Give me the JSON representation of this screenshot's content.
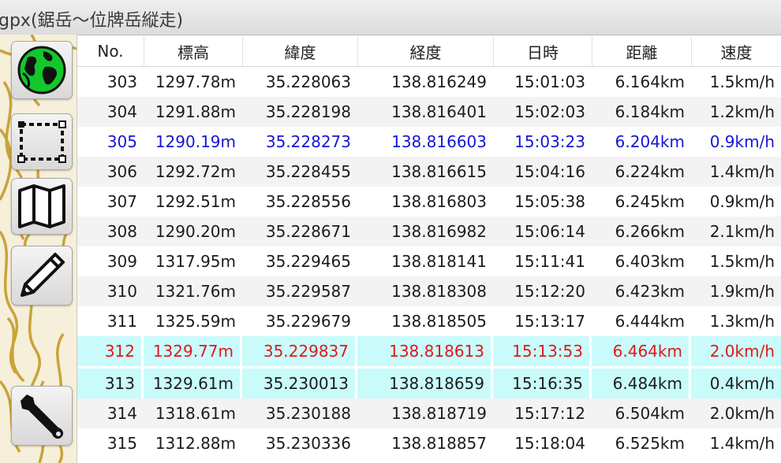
{
  "window": {
    "title": "gpx(鋸岳〜位牌岳縦走)"
  },
  "toolbar": {
    "buttons": [
      {
        "id": "globe",
        "icon": "globe-icon"
      },
      {
        "id": "select",
        "icon": "selection-rect-icon"
      },
      {
        "id": "map",
        "icon": "map-icon"
      },
      {
        "id": "edit",
        "icon": "pencil-icon"
      },
      {
        "id": "settings",
        "icon": "wrench-icon"
      }
    ]
  },
  "table": {
    "columns": [
      "No.",
      "標高",
      "緯度",
      "経度",
      "日時",
      "距離",
      "速度"
    ],
    "rows": [
      [
        "303",
        "1297.78m",
        "35.228063",
        "138.816249",
        "15:01:03",
        "6.164km",
        "1.5km/h"
      ],
      [
        "304",
        "1291.88m",
        "35.228198",
        "138.816401",
        "15:02:03",
        "6.184km",
        "1.2km/h"
      ],
      [
        "305",
        "1290.19m",
        "35.228273",
        "138.816603",
        "15:03:23",
        "6.204km",
        "0.9km/h"
      ],
      [
        "306",
        "1292.72m",
        "35.228455",
        "138.816615",
        "15:04:16",
        "6.224km",
        "1.4km/h"
      ],
      [
        "307",
        "1292.51m",
        "35.228556",
        "138.816803",
        "15:05:38",
        "6.245km",
        "0.9km/h"
      ],
      [
        "308",
        "1290.20m",
        "35.228671",
        "138.816982",
        "15:06:14",
        "6.266km",
        "2.1km/h"
      ],
      [
        "309",
        "1317.95m",
        "35.229465",
        "138.818141",
        "15:11:41",
        "6.403km",
        "1.5km/h"
      ],
      [
        "310",
        "1321.76m",
        "35.229587",
        "138.818308",
        "15:12:20",
        "6.423km",
        "1.9km/h"
      ],
      [
        "311",
        "1325.59m",
        "35.229679",
        "138.818505",
        "15:13:17",
        "6.444km",
        "1.3km/h"
      ],
      [
        "312",
        "1329.77m",
        "35.229837",
        "138.818613",
        "15:13:53",
        "6.464km",
        "2.0km/h"
      ],
      [
        "313",
        "1329.61m",
        "35.230013",
        "138.818659",
        "15:16:35",
        "6.484km",
        "0.4km/h"
      ],
      [
        "314",
        "1318.61m",
        "35.230188",
        "138.818719",
        "15:17:12",
        "6.504km",
        "2.0km/h"
      ],
      [
        "315",
        "1312.88m",
        "35.230336",
        "138.818857",
        "15:18:04",
        "6.525km",
        "1.4km/h"
      ]
    ],
    "row_styles": {
      "2": "sel-blue",
      "9": "sel-red",
      "10": "hl-cyan"
    }
  },
  "colors": {
    "selected_text_blue": "#1515d6",
    "selected_text_red": "#e0191c",
    "highlight_cyan": "#c9fbfb",
    "contour_gold": "#c9a33a"
  }
}
